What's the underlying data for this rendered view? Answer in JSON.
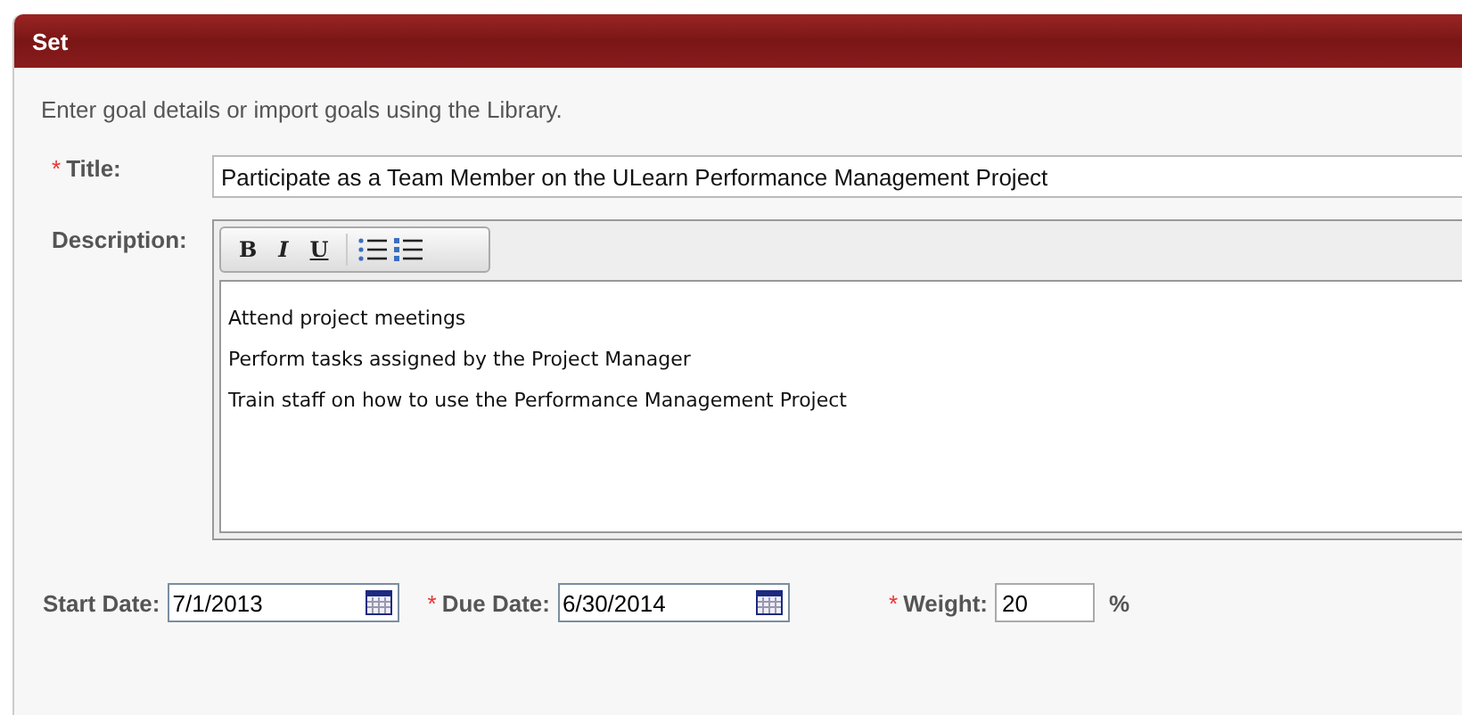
{
  "panel": {
    "title": "Set"
  },
  "required_mark": "*",
  "intro": "Enter goal details or import goals using the Library.",
  "title_field": {
    "label": "Title:",
    "required": true,
    "value": "Participate as a Team Member on the ULearn Performance Management Project"
  },
  "description": {
    "label": "Description:",
    "required": false,
    "toolbar": [
      {
        "kind": "bold",
        "label": "B"
      },
      {
        "kind": "italic",
        "label": "I"
      },
      {
        "kind": "underline",
        "label": "U"
      },
      {
        "kind": "bullets"
      },
      {
        "kind": "numbers"
      }
    ],
    "lines": [
      "Attend project meetings",
      "Perform tasks assigned by the Project Manager",
      "Train staff on how to use the Performance Management Project"
    ]
  },
  "fields": [
    {
      "kind": "date",
      "label": "Start Date:",
      "required": false,
      "value": "7/1/2013"
    },
    {
      "kind": "date",
      "label": "Due Date:",
      "required": true,
      "value": "6/30/2014"
    },
    {
      "kind": "number",
      "label": "Weight:",
      "required": true,
      "value": "20",
      "unit": "%"
    }
  ]
}
